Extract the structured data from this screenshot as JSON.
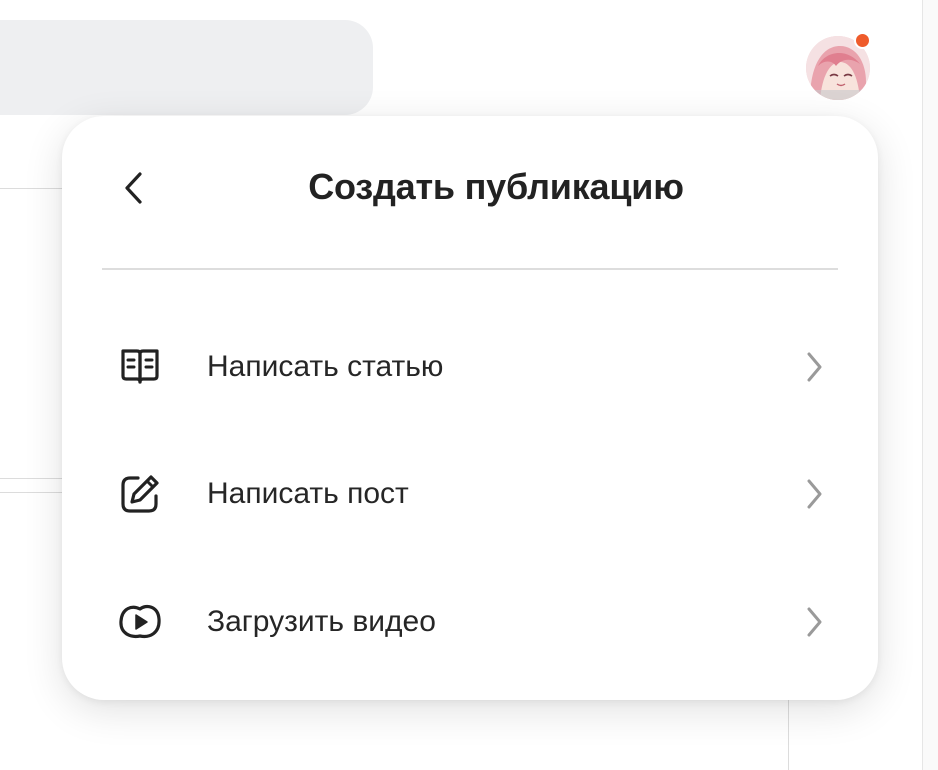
{
  "menu": {
    "title": "Создать публикацию",
    "items": [
      {
        "label": "Написать статью",
        "icon": "book-open-icon"
      },
      {
        "label": "Написать пост",
        "icon": "edit-pencil-icon"
      },
      {
        "label": "Загрузить видео",
        "icon": "video-play-icon"
      }
    ]
  },
  "colors": {
    "notification_dot": "#ef5b2b",
    "search_bar_bg": "#eeeff1",
    "text_primary": "#222222",
    "chevron": "#9a9a9a"
  }
}
